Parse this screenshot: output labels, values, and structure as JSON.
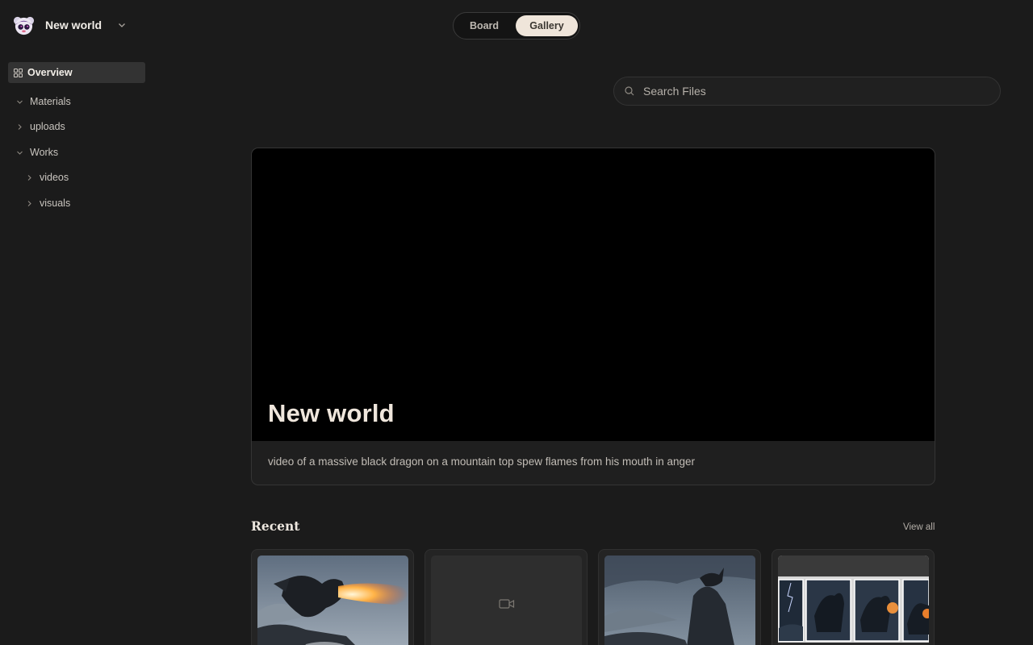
{
  "workspace": {
    "name": "New world",
    "logo_icon": "mascot-logo-icon"
  },
  "sidebar": {
    "overview_label": "Overview",
    "tree": [
      {
        "label": "Materials",
        "state": "expanded",
        "depth": 0
      },
      {
        "label": "uploads",
        "state": "collapsed",
        "depth": 1
      },
      {
        "label": "Works",
        "state": "expanded",
        "depth": 0
      },
      {
        "label": "videos",
        "state": "collapsed",
        "depth": 2
      },
      {
        "label": "visuals",
        "state": "collapsed",
        "depth": 2
      }
    ]
  },
  "view_toggle": {
    "options": [
      "Board",
      "Gallery"
    ],
    "selected": "Gallery"
  },
  "search": {
    "placeholder": "Search Files",
    "value": ""
  },
  "hero": {
    "title": "New world",
    "description": "video of a massive black dragon on a mountain top spew flames from his mouth in anger"
  },
  "recent": {
    "title": "Recent",
    "view_all_label": "View all",
    "items": [
      {
        "kind": "image",
        "subject": "dragon breathing fire on snowy cliff"
      },
      {
        "kind": "video",
        "icon": "video-camera-icon"
      },
      {
        "kind": "image",
        "subject": "dragon on stormy mountain peak"
      },
      {
        "kind": "image",
        "subject": "dragon storyboard frames"
      }
    ]
  },
  "colors": {
    "background": "#1b1b1b",
    "accent_toggle": "#efe5da",
    "text_primary": "#e6e2dc"
  }
}
